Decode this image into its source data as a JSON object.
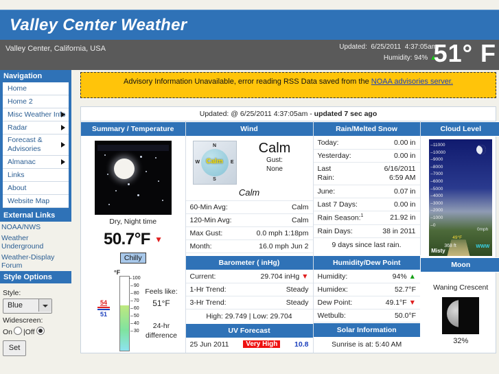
{
  "header": {
    "site_title": "Valley Center Weather",
    "location": "Valley Center, California, USA",
    "updated_label": "Updated:",
    "updated_date": "6/25/2011",
    "updated_time": "4:37:05am",
    "humidity_label": "Humidity:",
    "humidity_value": "94%",
    "humidity_trend_icon": "up-arrow-icon",
    "current_temp": "51° F",
    "brand_blue": "#2f72b7",
    "subbar_gray": "#5a5a5a"
  },
  "sidebar": {
    "nav_header": "Navigation",
    "nav_items": [
      {
        "label": "Home",
        "has_submenu": false
      },
      {
        "label": "Home 2",
        "has_submenu": false
      },
      {
        "label": "Misc Weather Info",
        "has_submenu": true
      },
      {
        "label": "Radar",
        "has_submenu": true
      },
      {
        "label": "Forecast & Advisories",
        "has_submenu": true
      },
      {
        "label": "Almanac",
        "has_submenu": true
      },
      {
        "label": "Links",
        "has_submenu": false
      },
      {
        "label": "About",
        "has_submenu": false
      },
      {
        "label": "Website Map",
        "has_submenu": false
      }
    ],
    "external_header": "External Links",
    "external_items": [
      "NOAA/NWS",
      "Weather Underground",
      "Weather-Display Forum"
    ],
    "style_header": "Style Options",
    "style_label": "Style:",
    "style_value": "Blue",
    "widescreen_label": "Widescreen:",
    "widescreen_on": "On",
    "widescreen_divider": "|",
    "widescreen_off": "Off",
    "widescreen_selected": "Off",
    "set_button": "Set"
  },
  "advisory": {
    "text": "Advisory Information Unavailable, error reading RSS Data saved from the ",
    "link": "NOAA advisories server."
  },
  "updated_line": {
    "prefix": "Updated: @ 6/25/2011 4:37:05am - ",
    "suffix": "updated 7 sec ago"
  },
  "panels": {
    "summary": {
      "header": "Summary / Temperature",
      "caption": "Dry, Night time",
      "temp": "50.7°F",
      "temp_trend_icon": "down-arrow-icon",
      "badge": "Chilly",
      "thermo_unit": "°F",
      "thermo_ticks": [
        "100",
        "90",
        "80",
        "70",
        "60",
        "50",
        "40",
        "30"
      ],
      "mark_high": "54",
      "mark_low": "51",
      "feels_like_label": "Feels like:",
      "feels_like_value": "51°F",
      "diff_label_1": "24-hr",
      "diff_label_2": "difference"
    },
    "wind": {
      "header": "Wind",
      "compass_center": "Calm",
      "compass_n": "N",
      "compass_s": "S",
      "compass_e": "E",
      "compass_w": "W",
      "speed": "Calm",
      "gust_label": "Gust:",
      "gust_value": "None",
      "direction": "Calm",
      "rows": [
        {
          "label": "60-Min Avg:",
          "value": "Calm"
        },
        {
          "label": "120-Min Avg:",
          "value": "Calm"
        },
        {
          "label": "Max Gust:",
          "value": "0.0 mph 1:18pm"
        },
        {
          "label": "Month:",
          "value": "16.0 mph Jun 2"
        }
      ]
    },
    "rain": {
      "header": "Rain/Melted Snow",
      "rows": [
        {
          "label": "Today:",
          "value": "0.00 in"
        },
        {
          "label": "Yesterday:",
          "value": "0.00 in"
        },
        {
          "label": "Last Rain:",
          "value": "6/16/2011 6:59 AM",
          "two_line": true
        },
        {
          "label": "June:",
          "value": "0.07 in"
        },
        {
          "label": "Last 7 Days:",
          "value": "0.00 in"
        },
        {
          "label": "Rain Season:",
          "sup": "1",
          "value": "21.92 in"
        },
        {
          "label": "Rain Days:",
          "value": "38 in 2011"
        }
      ],
      "footer": "9 days since last rain."
    },
    "cloud": {
      "header": "Cloud Level",
      "scale": [
        "11000",
        "10000",
        "9000",
        "8000",
        "7000",
        "6000",
        "5000",
        "4000",
        "3000",
        "2000",
        "1000",
        "0"
      ],
      "altitude": "368 ft",
      "temp_overlay": "49°F",
      "wind_overlay": "0mph",
      "condition": "Misty",
      "watermark": "WWW"
    },
    "barometer": {
      "header": "Barometer ( inHg)",
      "rows": [
        {
          "label": "Current:",
          "value": "29.704 inHg",
          "trend": "down"
        },
        {
          "label": "1-Hr Trend:",
          "value": "Steady"
        },
        {
          "label": "3-Hr Trend:",
          "value": "Steady"
        }
      ],
      "footer": "High: 29.749 |  Low:  29.704"
    },
    "humidity": {
      "header": "Humidity/Dew Point",
      "rows": [
        {
          "label": "Humidity:",
          "value": "94%",
          "trend": "up"
        },
        {
          "label": "Humidex:",
          "value": "52.7°F"
        },
        {
          "label": "Dew Point:",
          "value": "49.1°F",
          "trend": "down"
        },
        {
          "label": "Wetbulb:",
          "value": "50.0°F"
        }
      ]
    },
    "moon": {
      "header": "Moon",
      "phase": "Waning Crescent",
      "percent": "32%"
    },
    "uv": {
      "header": "UV Forecast",
      "date": "25 Jun 2011",
      "level": "Very High",
      "value": "10.8"
    },
    "solar": {
      "header": "Solar Information",
      "sunrise": "Sunrise is at: 5:40 AM"
    }
  }
}
